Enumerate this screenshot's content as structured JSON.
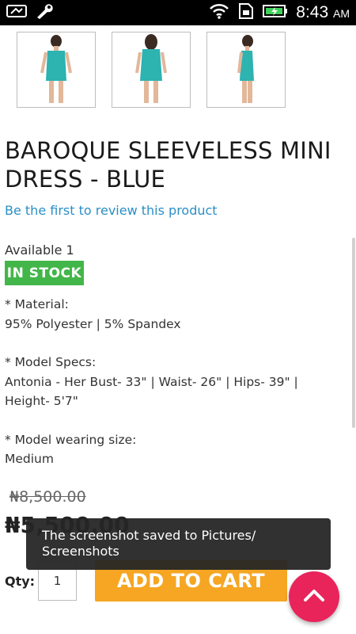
{
  "statusbar": {
    "time": "8:43",
    "ampm": "AM"
  },
  "product": {
    "title": "BAROQUE SLEEVELESS MINI DRESS - BLUE",
    "review_link": "Be the first to review this product",
    "availability": "Available 1",
    "stock": "IN STOCK",
    "description": {
      "material_label": "* Material:",
      "material_value": "95% Polyester | 5% Spandex",
      "model_specs_label": "* Model Specs:",
      "model_specs_value": "Antonia - Her Bust- 33\" | Waist- 26\" | Hips- 39\" | Height- 5'7\"",
      "wearing_size_label": "* Model wearing size:",
      "wearing_size_value": "Medium"
    },
    "old_price": "₦8,500.00",
    "new_price": "₦5,500.00"
  },
  "cart": {
    "qty_label": "Qty:",
    "qty_value": "1",
    "add_label": "ADD TO CART"
  },
  "toast": {
    "message": "The screenshot saved to Pictures/ Screenshots"
  },
  "colors": {
    "accent": "#f6a623",
    "stock": "#43b649",
    "link": "#2a8fc4",
    "fab": "#e8245a"
  },
  "icons": [
    "screenshot-icon",
    "wrench-icon",
    "wifi-icon",
    "sim-icon",
    "battery-icon",
    "chevron-up-icon"
  ]
}
